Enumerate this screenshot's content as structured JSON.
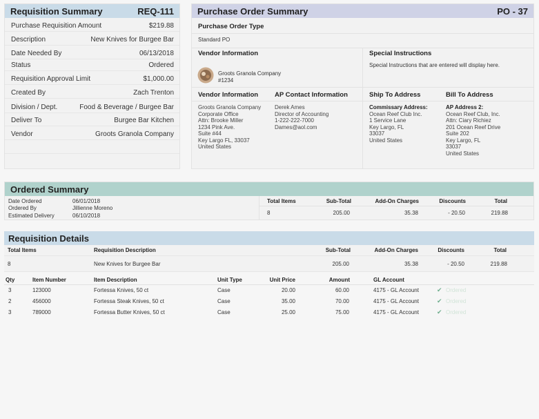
{
  "requisition_summary": {
    "title": "Requisition Summary",
    "req_id": "REQ-111",
    "rows": [
      {
        "label": "Purchase Requisition Amount",
        "value": "$219.88"
      },
      {
        "label": "Description",
        "value": "New Knives for Burgee Bar"
      },
      {
        "label": "Date Needed By",
        "value": "06/13/2018"
      },
      {
        "label": "Status",
        "value": "Ordered"
      },
      {
        "label": "Requisition Approval Limit",
        "value": "$1,000.00"
      },
      {
        "label": "Created By",
        "value": "Zach Trenton"
      },
      {
        "label": "Division / Dept.",
        "value": "Food & Beverage / Burgee Bar"
      },
      {
        "label": "Deliver To",
        "value": "Burgee Bar Kitchen"
      },
      {
        "label": "Vendor",
        "value": "Groots Granola Company"
      }
    ]
  },
  "purchase_order_summary": {
    "title": "Purchase Order Summary",
    "po_id": "PO - 37",
    "po_type_label": "Purchase Order Type",
    "po_type_value": "Standard PO",
    "vendor_info_label": "Vendor Information",
    "vendor_name": "Groots Granola Company",
    "vendor_number": "#1234",
    "special_instructions_label": "Special Instructions",
    "special_instructions_text": "Special Instructions that are entered will display here.",
    "vendor_info2_label": "Vendor Information",
    "vendor_address": [
      "Groots Granola Company",
      "Corporate Office",
      "Attn: Brooke Miller",
      "1234 Pink Ave.",
      "Suite #44",
      "Key Largo FL, 33037",
      "United States"
    ],
    "ap_contact_label": "AP Contact Information",
    "ap_contact": [
      "Derek Ames",
      "Director of Accounting",
      "1-222-222-7000",
      "Dames@aol.com"
    ],
    "ship_to_label": "Ship To Address",
    "ship_to_title": "Commissary Address:",
    "ship_to": [
      "Ocean Reef Club Inc.",
      "1 Service Lane",
      "Key Largo, FL",
      "33037",
      "United States"
    ],
    "bill_to_label": "Bill To Address",
    "bill_to_title": "AP Address 2:",
    "bill_to": [
      "Ocean Reef Club, Inc.",
      "Attn: Ciary Richiez",
      "201 Ocean Reef Drive",
      "Suite 202",
      "Key Largo, FL",
      "33037",
      "United States"
    ]
  },
  "ordered_summary": {
    "title": "Ordered Summary",
    "info": [
      {
        "label": "Date Ordered",
        "value": "06/01/2018"
      },
      {
        "label": "Ordered By",
        "value": "Jillienne Moreno"
      },
      {
        "label": "Estimated Delivery",
        "value": "06/10/2018"
      }
    ],
    "headers": {
      "total_items": "Total Items",
      "sub_total": "Sub-Total",
      "add_on": "Add-On Charges",
      "discounts": "Discounts",
      "total": "Total"
    },
    "values": {
      "total_items": "8",
      "sub_total": "205.00",
      "add_on": "35.38",
      "discounts": "- 20.50",
      "total": "219.88"
    }
  },
  "requisition_details": {
    "title": "Requisition Details",
    "summary_headers": {
      "total_items": "Total Items",
      "description": "Requisition Description",
      "sub_total": "Sub-Total",
      "add_on": "Add-On Charges",
      "discounts": "Discounts",
      "total": "Total"
    },
    "summary_values": {
      "total_items": "8",
      "description": "New Knives for Burgee Bar",
      "sub_total": "205.00",
      "add_on": "35.38",
      "discounts": "- 20.50",
      "total": "219.88"
    },
    "item_headers": {
      "qty": "Qty",
      "item_number": "Item Number",
      "item_description": "Item Description",
      "unit_type": "Unit Type",
      "unit_price": "Unit Price",
      "amount": "Amount",
      "gl_account": "GL Account"
    },
    "items": [
      {
        "qty": "3",
        "item_number": "123000",
        "description": "Fortessa Knives, 50 ct",
        "unit_type": "Case",
        "unit_price": "20.00",
        "amount": "60.00",
        "gl_account": "4175 - GL Account",
        "status": "Ordered"
      },
      {
        "qty": "2",
        "item_number": "456000",
        "description": "Fortessa Steak Knives, 50 ct",
        "unit_type": "Case",
        "unit_price": "35.00",
        "amount": "70.00",
        "gl_account": "4175 - GL Account",
        "status": "Ordered"
      },
      {
        "qty": "3",
        "item_number": "789000",
        "description": "Fortessa Butter Knives, 50 ct",
        "unit_type": "Case",
        "unit_price": "25.00",
        "amount": "75.00",
        "gl_account": "4175 - GL Account",
        "status": "Ordered"
      }
    ]
  },
  "icons": {
    "check": "checkmark-icon",
    "vendor_avatar": "vendor-logo-icon"
  }
}
